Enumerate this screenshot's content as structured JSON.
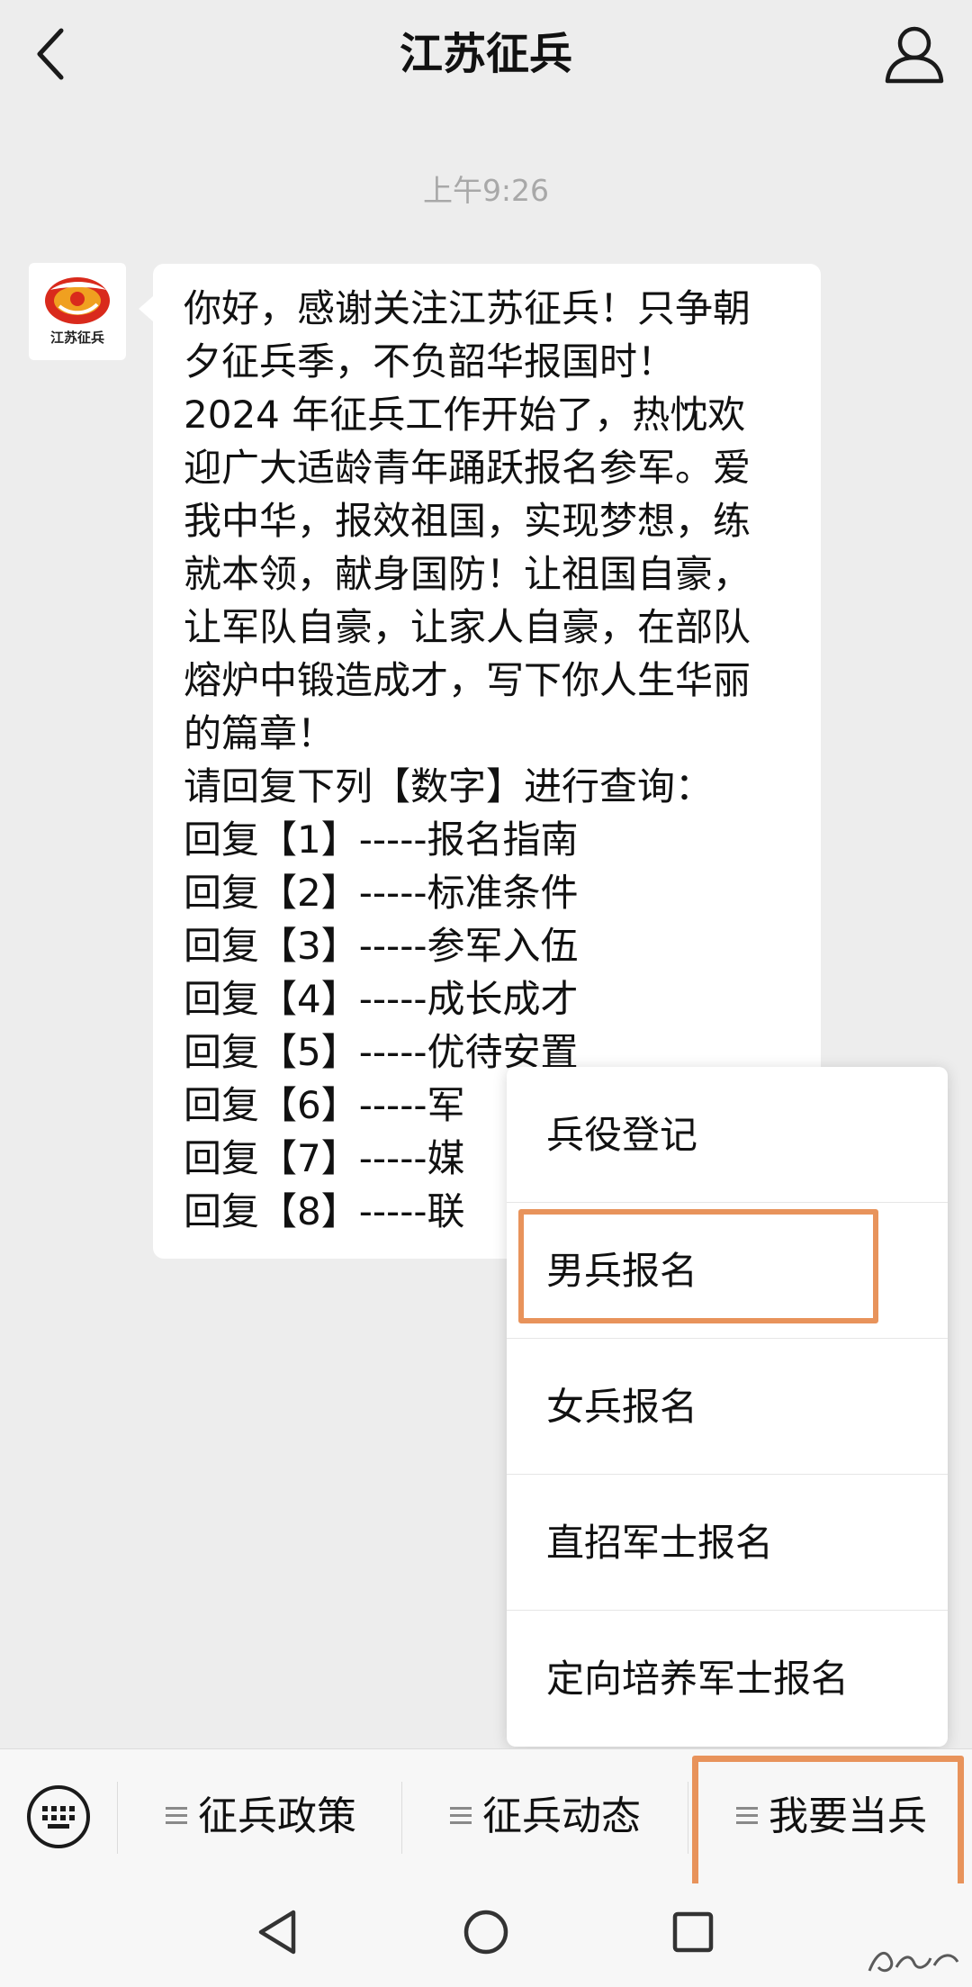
{
  "header": {
    "title": "江苏征兵"
  },
  "chat": {
    "timestamp": "上午9:26",
    "avatar_text": "江苏征兵",
    "message_lines": [
      "你好，感谢关注江苏征兵！只争朝",
      "夕征兵季，不负韶华报国时！",
      "2024 年征兵工作开始了，热忱欢",
      "迎广大适龄青年踊跃报名参军。爱",
      "我中华，报效祖国，实现梦想，练",
      "就本领，献身国防！让祖国自豪，",
      "让军队自豪，让家人自豪，在部队",
      "熔炉中锻造成才，写下你人生华丽",
      "的篇章！",
      "请回复下列【数字】进行查询："
    ],
    "replies": [
      {
        "prefix": "回复【1】-----",
        "label": "报名指南"
      },
      {
        "prefix": "回复【2】-----",
        "label": "标准条件"
      },
      {
        "prefix": "回复【3】-----",
        "label": "参军入伍"
      },
      {
        "prefix": "回复【4】-----",
        "label": "成长成才"
      },
      {
        "prefix": "回复【5】-----",
        "label": "优待安置"
      },
      {
        "prefix": "回复【6】-----",
        "label": "军"
      },
      {
        "prefix": "回复【7】-----",
        "label": "媒"
      },
      {
        "prefix": "回复【8】-----",
        "label": "联"
      }
    ]
  },
  "popup_menu": {
    "items": [
      {
        "label": "兵役登记"
      },
      {
        "label": "男兵报名"
      },
      {
        "label": "女兵报名"
      },
      {
        "label": "直招军士报名"
      },
      {
        "label": "定向培养军士报名"
      }
    ],
    "highlighted_item": "男兵报名"
  },
  "bottom_menu": {
    "items": [
      {
        "label": "征兵政策"
      },
      {
        "label": "征兵动态"
      },
      {
        "label": "我要当兵"
      }
    ],
    "highlighted_item": "我要当兵"
  },
  "icons": {
    "back": "chevron-left-icon",
    "profile": "person-icon",
    "keyboard": "keyboard-icon",
    "menu_glyph": "menu-lines-icon",
    "nav_back": "triangle-back-icon",
    "nav_home": "circle-home-icon",
    "nav_recent": "square-recent-icon"
  },
  "colors": {
    "background": "#ededed",
    "bubble": "#ffffff",
    "highlight": "#e8935b",
    "timestamp": "#a8a8a8",
    "logo_red": "#d92a1c",
    "logo_orange": "#f0a020"
  }
}
